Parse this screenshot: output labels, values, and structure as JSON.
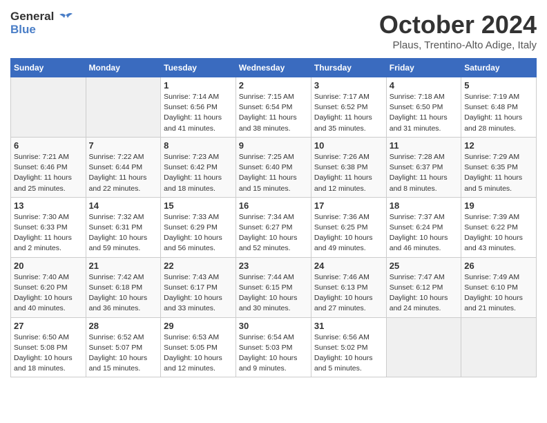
{
  "header": {
    "logo_general": "General",
    "logo_blue": "Blue",
    "month_title": "October 2024",
    "location": "Plaus, Trentino-Alto Adige, Italy"
  },
  "weekdays": [
    "Sunday",
    "Monday",
    "Tuesday",
    "Wednesday",
    "Thursday",
    "Friday",
    "Saturday"
  ],
  "weeks": [
    [
      {
        "day": "",
        "empty": true
      },
      {
        "day": "",
        "empty": true
      },
      {
        "day": "1",
        "sunrise": "7:14 AM",
        "sunset": "6:56 PM",
        "daylight": "11 hours and 41 minutes."
      },
      {
        "day": "2",
        "sunrise": "7:15 AM",
        "sunset": "6:54 PM",
        "daylight": "11 hours and 38 minutes."
      },
      {
        "day": "3",
        "sunrise": "7:17 AM",
        "sunset": "6:52 PM",
        "daylight": "11 hours and 35 minutes."
      },
      {
        "day": "4",
        "sunrise": "7:18 AM",
        "sunset": "6:50 PM",
        "daylight": "11 hours and 31 minutes."
      },
      {
        "day": "5",
        "sunrise": "7:19 AM",
        "sunset": "6:48 PM",
        "daylight": "11 hours and 28 minutes."
      }
    ],
    [
      {
        "day": "6",
        "sunrise": "7:21 AM",
        "sunset": "6:46 PM",
        "daylight": "11 hours and 25 minutes."
      },
      {
        "day": "7",
        "sunrise": "7:22 AM",
        "sunset": "6:44 PM",
        "daylight": "11 hours and 22 minutes."
      },
      {
        "day": "8",
        "sunrise": "7:23 AM",
        "sunset": "6:42 PM",
        "daylight": "11 hours and 18 minutes."
      },
      {
        "day": "9",
        "sunrise": "7:25 AM",
        "sunset": "6:40 PM",
        "daylight": "11 hours and 15 minutes."
      },
      {
        "day": "10",
        "sunrise": "7:26 AM",
        "sunset": "6:38 PM",
        "daylight": "11 hours and 12 minutes."
      },
      {
        "day": "11",
        "sunrise": "7:28 AM",
        "sunset": "6:37 PM",
        "daylight": "11 hours and 8 minutes."
      },
      {
        "day": "12",
        "sunrise": "7:29 AM",
        "sunset": "6:35 PM",
        "daylight": "11 hours and 5 minutes."
      }
    ],
    [
      {
        "day": "13",
        "sunrise": "7:30 AM",
        "sunset": "6:33 PM",
        "daylight": "11 hours and 2 minutes."
      },
      {
        "day": "14",
        "sunrise": "7:32 AM",
        "sunset": "6:31 PM",
        "daylight": "10 hours and 59 minutes."
      },
      {
        "day": "15",
        "sunrise": "7:33 AM",
        "sunset": "6:29 PM",
        "daylight": "10 hours and 56 minutes."
      },
      {
        "day": "16",
        "sunrise": "7:34 AM",
        "sunset": "6:27 PM",
        "daylight": "10 hours and 52 minutes."
      },
      {
        "day": "17",
        "sunrise": "7:36 AM",
        "sunset": "6:25 PM",
        "daylight": "10 hours and 49 minutes."
      },
      {
        "day": "18",
        "sunrise": "7:37 AM",
        "sunset": "6:24 PM",
        "daylight": "10 hours and 46 minutes."
      },
      {
        "day": "19",
        "sunrise": "7:39 AM",
        "sunset": "6:22 PM",
        "daylight": "10 hours and 43 minutes."
      }
    ],
    [
      {
        "day": "20",
        "sunrise": "7:40 AM",
        "sunset": "6:20 PM",
        "daylight": "10 hours and 40 minutes."
      },
      {
        "day": "21",
        "sunrise": "7:42 AM",
        "sunset": "6:18 PM",
        "daylight": "10 hours and 36 minutes."
      },
      {
        "day": "22",
        "sunrise": "7:43 AM",
        "sunset": "6:17 PM",
        "daylight": "10 hours and 33 minutes."
      },
      {
        "day": "23",
        "sunrise": "7:44 AM",
        "sunset": "6:15 PM",
        "daylight": "10 hours and 30 minutes."
      },
      {
        "day": "24",
        "sunrise": "7:46 AM",
        "sunset": "6:13 PM",
        "daylight": "10 hours and 27 minutes."
      },
      {
        "day": "25",
        "sunrise": "7:47 AM",
        "sunset": "6:12 PM",
        "daylight": "10 hours and 24 minutes."
      },
      {
        "day": "26",
        "sunrise": "7:49 AM",
        "sunset": "6:10 PM",
        "daylight": "10 hours and 21 minutes."
      }
    ],
    [
      {
        "day": "27",
        "sunrise": "6:50 AM",
        "sunset": "5:08 PM",
        "daylight": "10 hours and 18 minutes."
      },
      {
        "day": "28",
        "sunrise": "6:52 AM",
        "sunset": "5:07 PM",
        "daylight": "10 hours and 15 minutes."
      },
      {
        "day": "29",
        "sunrise": "6:53 AM",
        "sunset": "5:05 PM",
        "daylight": "10 hours and 12 minutes."
      },
      {
        "day": "30",
        "sunrise": "6:54 AM",
        "sunset": "5:03 PM",
        "daylight": "10 hours and 9 minutes."
      },
      {
        "day": "31",
        "sunrise": "6:56 AM",
        "sunset": "5:02 PM",
        "daylight": "10 hours and 5 minutes."
      },
      {
        "day": "",
        "empty": true
      },
      {
        "day": "",
        "empty": true
      }
    ]
  ]
}
